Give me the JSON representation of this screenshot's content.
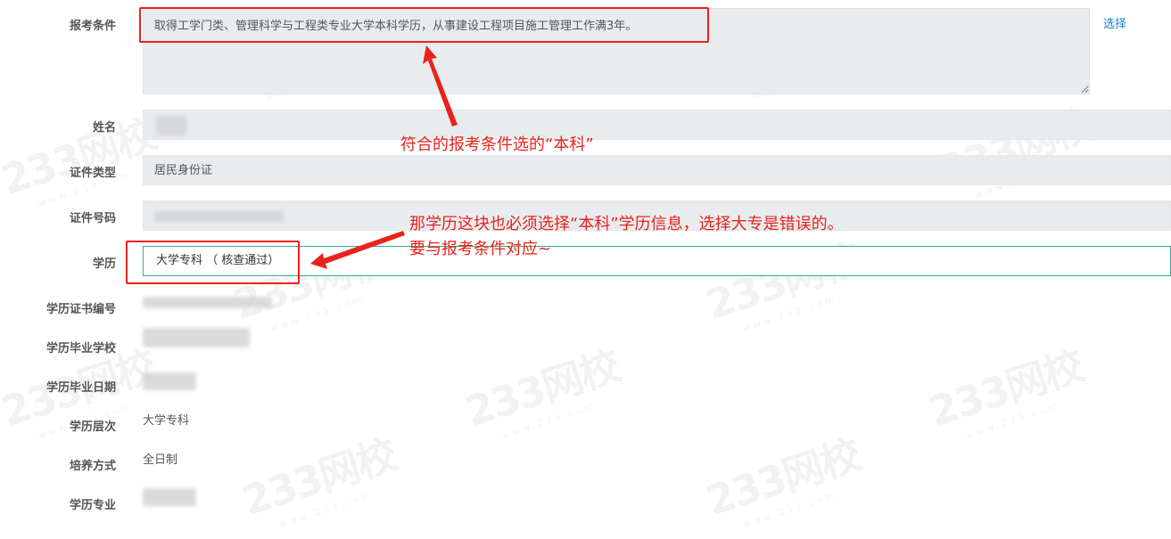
{
  "form": {
    "condition_label": "报考条件",
    "condition_value": "取得工学门类、管理科学与工程类专业大学本科学历，从事建设工程项目施工管理工作满3年。",
    "select_link": "选择",
    "name_label": "姓名",
    "id_type_label": "证件类型",
    "id_type_value": "居民身份证",
    "id_number_label": "证件号码",
    "education_label": "学历",
    "education_value": "大学专科 （ 核查通过）",
    "cert_no_label": "学历证书编号",
    "school_label": "学历毕业学校",
    "grad_date_label": "学历毕业日期",
    "level_label": "学历层次",
    "level_value": "大学专科",
    "mode_label": "培养方式",
    "mode_value": "全日制",
    "major_label": "学历专业"
  },
  "annotations": {
    "note1": "符合的报考条件选的“本科”",
    "note2_line1": "那学历这块也必须选择“本科”学历信息，选择大专是错误的。",
    "note2_line2": "要与报考条件对应~"
  },
  "watermark": {
    "brand": "233网校",
    "url": "www.233.com"
  },
  "colors": {
    "annotation_red": "#e8231b",
    "link_blue": "#1a7fd3",
    "focus_green": "#3aa889",
    "field_bg": "#e9ecef"
  }
}
